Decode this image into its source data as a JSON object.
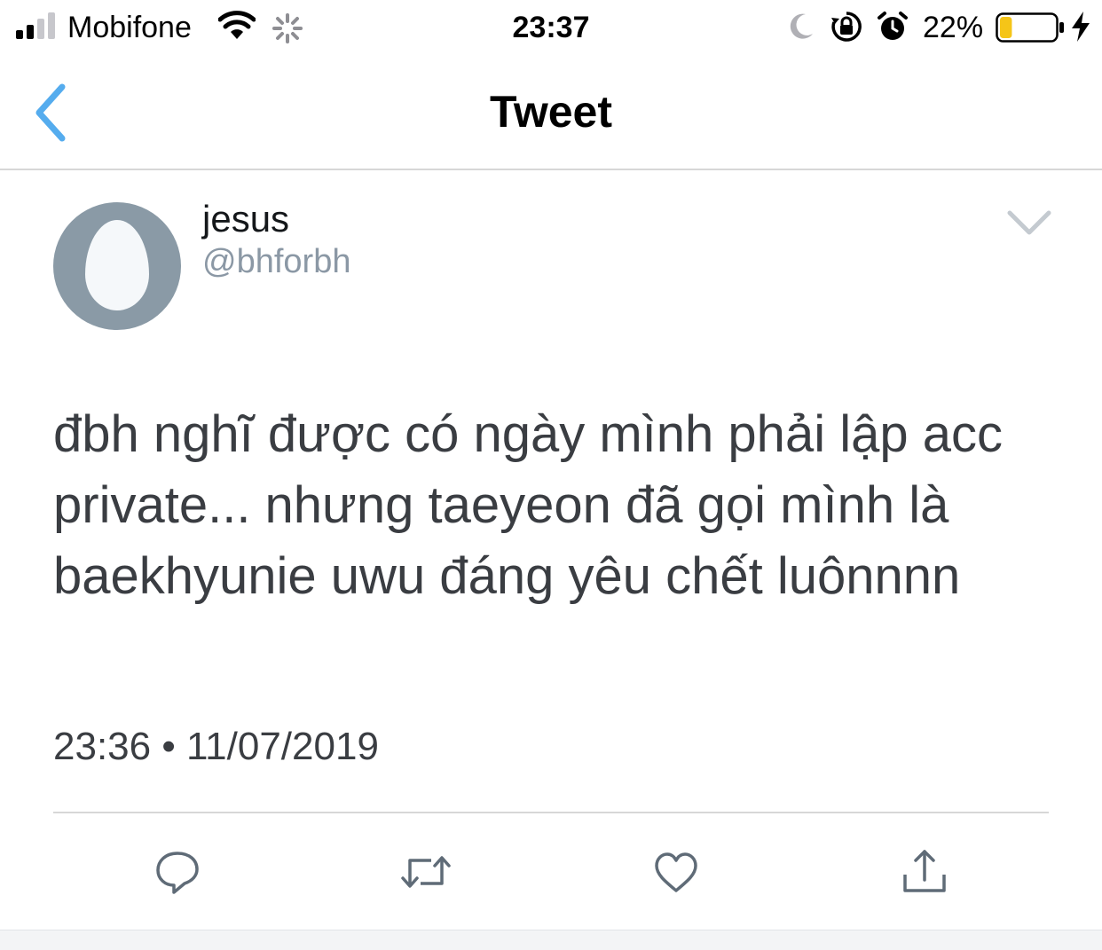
{
  "status_bar": {
    "carrier": "Mobifone",
    "time": "23:37",
    "battery_percent": "22%",
    "battery_level": 0.22,
    "battery_color": "#f5c518",
    "icons": [
      "signal-icon",
      "wifi-icon",
      "activity-spinner-icon",
      "moon-icon",
      "rotation-lock-icon",
      "alarm-icon",
      "battery-icon",
      "charging-bolt-icon"
    ]
  },
  "nav": {
    "title": "Tweet",
    "back_icon": "chevron-left-icon",
    "accent_color": "#55acee"
  },
  "tweet": {
    "display_name": "jesus",
    "handle": "@bhforbh",
    "avatar_color": "#8a9aa6",
    "text": "đbh nghĩ được có ngày mình phải lập acc private... nhưng taeyeon đã gọi mình là baekhyunie uwu đáng yêu chết luônnnn",
    "timestamp": "23:36 • 11/07/2019"
  },
  "actions": [
    "reply-icon",
    "retweet-icon",
    "like-icon",
    "share-icon"
  ]
}
